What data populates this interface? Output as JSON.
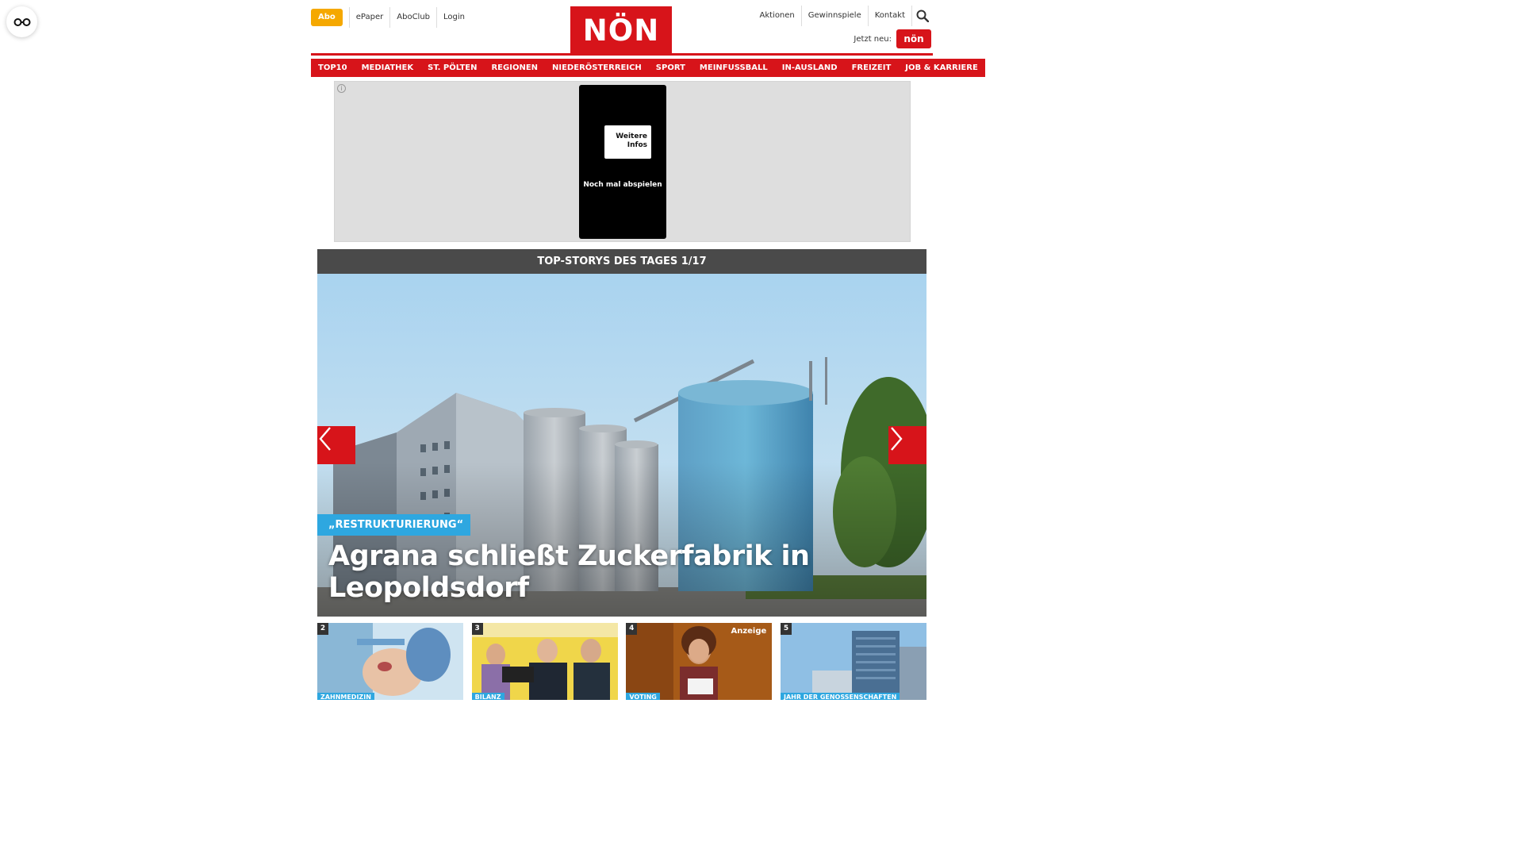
{
  "accessibility": {
    "icon": "glasses-icon"
  },
  "top_links": {
    "abo": "Abo",
    "left": [
      "ePaper",
      "AboClub",
      "Login"
    ],
    "right": [
      "Aktionen",
      "Gewinnspiele",
      "Kontakt"
    ]
  },
  "logo": {
    "text": "NÖN"
  },
  "jetzt_neu": {
    "label": "Jetzt neu:",
    "logo_text": "nön"
  },
  "nav": [
    "TOP10",
    "MEDIATHEK",
    "ST. PÖLTEN",
    "REGIONEN",
    "NIEDERÖSTERREICH",
    "SPORT",
    "MEINFUSSBALL",
    "IN-AUSLAND",
    "FREIZEIT",
    "JOB & KARRIERE"
  ],
  "ad": {
    "info": "i",
    "more_info": "Weitere Infos",
    "replay": "Noch mal abspielen"
  },
  "top_stories": {
    "header": "TOP-STORYS DES TAGES 1/17",
    "kicker": "„RESTRUKTURIERUNG“",
    "headline": "Agrana schließt Zuckerfabrik in Leopoldsdorf"
  },
  "teasers": [
    {
      "num": "2",
      "tag": "ZAHNMEDIZIN"
    },
    {
      "num": "3",
      "tag": "BILANZ"
    },
    {
      "num": "4",
      "tag": "VOTING",
      "badge": "Anzeige"
    },
    {
      "num": "5",
      "tag": "JAHR DER GENOSSENSCHAFTEN"
    }
  ],
  "colors": {
    "brand_red": "#d7141a",
    "abo_yellow": "#f5a800",
    "kicker_blue": "#2ea7e0",
    "header_gray": "#4a4a4a"
  }
}
